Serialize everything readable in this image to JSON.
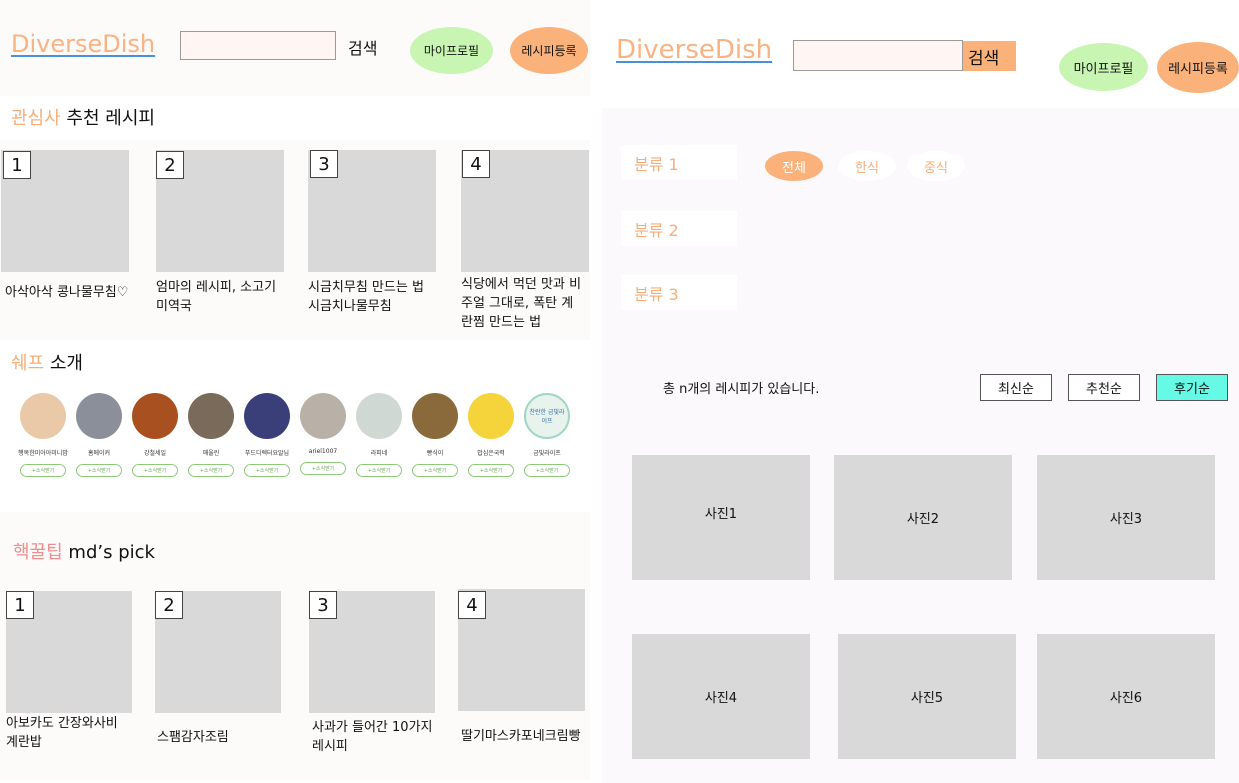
{
  "left": {
    "header": {
      "logo": "DiverseDish",
      "search_placeholder": "",
      "search_button": "검색",
      "profile_button": "마이프로필",
      "register_button": "레시피등록"
    },
    "interest": {
      "title_accent": "관심사",
      "title_rest": "추천 레시피",
      "items": [
        {
          "num": "1",
          "caption": "아삭아삭 콩나물무침♡"
        },
        {
          "num": "2",
          "caption": "엄마의 레시피, 소고기 미역국"
        },
        {
          "num": "3",
          "caption": "시금치무침 만드는 법 시금치나물무침"
        },
        {
          "num": "4",
          "caption": "식당에서 먹던 맛과 비주얼 그대로, 폭탄 계란찜 만드는 법"
        }
      ]
    },
    "chefs": {
      "title_accent": "쉐프",
      "title_rest": "소개",
      "subscribe_label": "+소식받기",
      "items": [
        {
          "name": "행복한미아아미니맘",
          "color": "#e9c9a8"
        },
        {
          "name": "홈메이커",
          "color": "#8a8f99"
        },
        {
          "name": "강철세일",
          "color": "#a8501f"
        },
        {
          "name": "매울린",
          "color": "#7a6a5a"
        },
        {
          "name": "푸드디렉터요알님",
          "color": "#3a3f7a"
        },
        {
          "name": "ariel1007",
          "color": "#b9b0a8"
        },
        {
          "name": "라피네",
          "color": "#cfd8d2"
        },
        {
          "name": "빵식이",
          "color": "#8a6a3a"
        },
        {
          "name": "밥심은국력",
          "color": "#F5D33A"
        },
        {
          "name": "금빛라이프",
          "color": "#e8f3ee"
        }
      ],
      "logo_text": "찬란한 금빛라이프"
    },
    "mdpick": {
      "title_accent": "핵꿀팁",
      "title_rest": "md’s pick",
      "items": [
        {
          "num": "1",
          "caption": "아보카도 간장와사비 계란밥"
        },
        {
          "num": "2",
          "caption": "스팸감자조림"
        },
        {
          "num": "3",
          "caption": "사과가 들어간 10가지 레시피"
        },
        {
          "num": "4",
          "caption": "딸기마스카포네크림빵"
        }
      ]
    }
  },
  "right": {
    "header": {
      "logo": "DiverseDish",
      "search_placeholder": "",
      "search_button": "검색",
      "profile_button": "마이프로필",
      "register_button": "레시피등록"
    },
    "categories": [
      "분류 1",
      "분류 2",
      "분류 3"
    ],
    "chips": [
      {
        "label": "전체",
        "active": true
      },
      {
        "label": "한식",
        "active": false
      },
      {
        "label": "중식",
        "active": false
      }
    ],
    "count_text": "총 n개의 레시피가 있습니다.",
    "sort": [
      {
        "label": "최신순",
        "active": false
      },
      {
        "label": "추천순",
        "active": false
      },
      {
        "label": "후기순",
        "active": true
      }
    ],
    "photos": [
      "사진1",
      "사진2",
      "사진3",
      "사진4",
      "사진5",
      "사진6"
    ]
  },
  "colors": {
    "accent_orange": "#F6AE79",
    "accent_pink": "#F08D8D",
    "pill_green": "#C9F5B2",
    "pill_orange": "#FAB27A",
    "sort_active": "#66FAE6",
    "placeholder_gray": "#D9D9D9"
  }
}
